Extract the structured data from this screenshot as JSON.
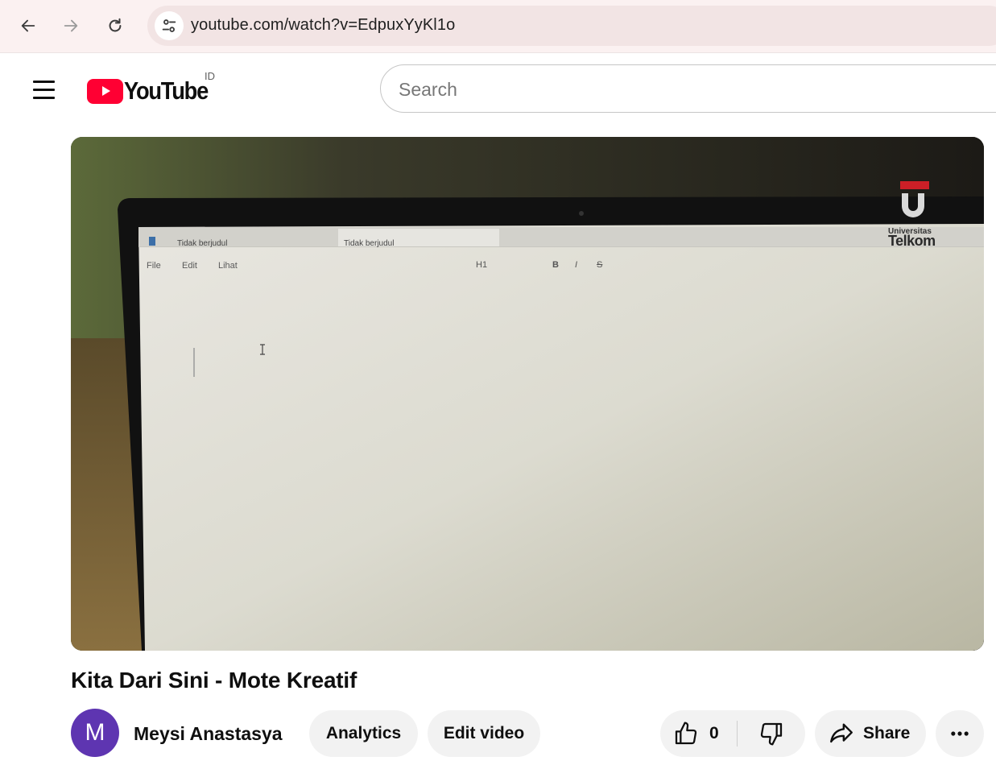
{
  "browser": {
    "url": "youtube.com/watch?v=EdpuxYyKl1o",
    "back_icon": "arrow-left-icon",
    "forward_icon": "arrow-right-icon",
    "reload_icon": "reload-icon",
    "site_info_icon": "tune-icon"
  },
  "header": {
    "logo_text": "YouTube",
    "region_code": "ID",
    "search_placeholder": "Search"
  },
  "video_frame": {
    "tabs": [
      "Tidak berjudul",
      "Tidak berjudul"
    ],
    "menu": [
      "File",
      "Edit",
      "Lihat"
    ],
    "heading_tool": "H1",
    "watermark_small": "Universitas",
    "watermark_big": "Telkom"
  },
  "video": {
    "title": "Kita Dari Sini - Mote Kreatif",
    "channel_name": "Meysi Anastasya",
    "avatar_letter": "M",
    "avatar_color": "#5e35b1"
  },
  "actions": {
    "analytics_label": "Analytics",
    "edit_label": "Edit video",
    "like_count": "0",
    "share_label": "Share"
  },
  "colors": {
    "brand_red": "#ff0033",
    "pill_bg": "#f2f2f2"
  }
}
